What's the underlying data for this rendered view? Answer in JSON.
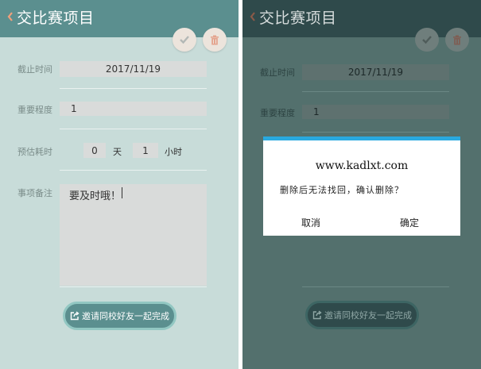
{
  "header": {
    "title": "交比赛项目"
  },
  "actions": {
    "check_icon": "check-icon",
    "trash_icon": "trash-icon"
  },
  "form": {
    "deadline_label": "截止时间",
    "deadline_value": "2017/11/19",
    "importance_label": "重要程度",
    "importance_value": "1",
    "estimate_label": "预估耗时",
    "estimate_days": "0",
    "estimate_days_unit": "天",
    "estimate_hours": "1",
    "estimate_hours_unit": "小时",
    "notes_label": "事项备注",
    "notes_value": "要及时哦！"
  },
  "invite_button": {
    "label": "邀请同校好友一起完成",
    "icon": "share-icon"
  },
  "dialog": {
    "site": "www.kadlxt.com",
    "message": "删除后无法找回，确认删除？",
    "cancel": "取消",
    "confirm": "确定"
  },
  "colors": {
    "header": "#5b8f8f",
    "background": "#c8dcd9",
    "dialog_accent": "#29a9df",
    "overlay_header": "#2f4a4b"
  }
}
